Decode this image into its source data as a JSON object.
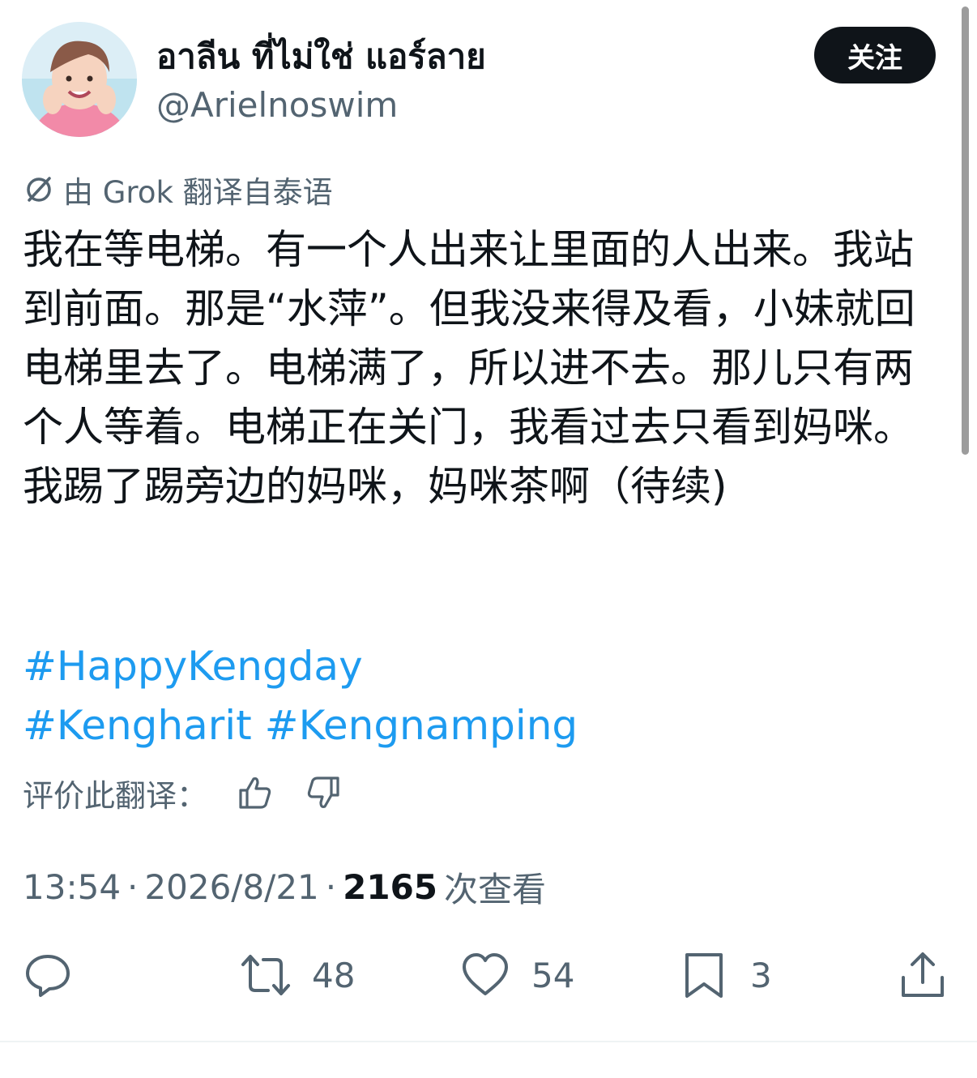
{
  "author": {
    "display_name": "อาลีน ที่ไม่ใช่ แอร์ลาย",
    "handle": "@Arielnoswim",
    "avatar_icon": "person-avatar"
  },
  "follow_button": {
    "label": "关注"
  },
  "translation_note": "由 Grok 翻译自泰语",
  "tweet_text": "我在等电梯。有一个人出来让里面的人出来。我站到前面。那是“水萍”。但我没来得及看，小妹就回电梯里去了。电梯满了，所以进不去。那儿只有两个人等着。电梯正在关门，我看过去只看到妈咪。我踢了踢旁边的妈咪，妈咪茶啊（待续)",
  "hashtags": [
    "#HappyKengday",
    "#Kengharit",
    "#Kengnamping"
  ],
  "rate_translation": {
    "label": "评价此翻译：",
    "thumbs_up_icon": "thumbs-up-icon",
    "thumbs_down_icon": "thumbs-down-icon"
  },
  "meta": {
    "time": "13:54",
    "date": "2026/8/21",
    "separator": "·",
    "views_count": "2165",
    "views_label": "次查看"
  },
  "actions": {
    "reply": {
      "icon": "reply-icon",
      "count": ""
    },
    "retweet": {
      "icon": "retweet-icon",
      "count": "48"
    },
    "like": {
      "icon": "heart-icon",
      "count": "54"
    },
    "bookmark": {
      "icon": "bookmark-icon",
      "count": "3"
    },
    "share": {
      "icon": "share-icon",
      "count": ""
    }
  },
  "colors": {
    "text": "#0f1419",
    "secondary": "#536471",
    "link": "#1d9bf0",
    "button_bg": "#0f1419"
  }
}
